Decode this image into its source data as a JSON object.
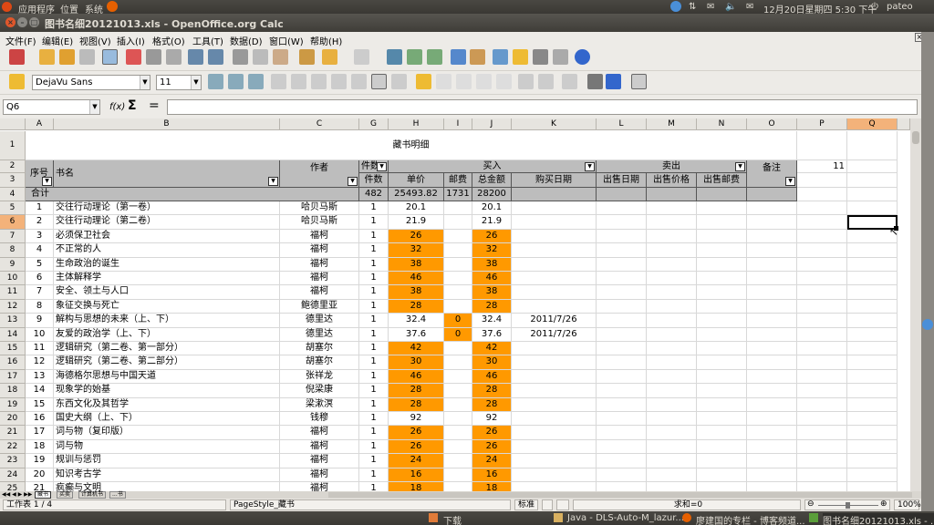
{
  "topbar": {
    "apps": "应用程序",
    "places": "位置",
    "system": "系统",
    "datetime": "12月20日星期四 5:30 下午",
    "user": "pateo"
  },
  "window": {
    "title": "图书名细20121013.xls - OpenOffice.org Calc"
  },
  "menu": [
    "文件(F)",
    "编辑(E)",
    "视图(V)",
    "插入(I)",
    "格式(O)",
    "工具(T)",
    "数据(D)",
    "窗口(W)",
    "帮助(H)"
  ],
  "format": {
    "font": "DejaVu Sans",
    "size": "11"
  },
  "formula": {
    "namebox": "Q6",
    "fx": "f(x)",
    "sigma": "Σ",
    "value": ""
  },
  "columns": [
    "A",
    "B",
    "C",
    "G",
    "H",
    "I",
    "J",
    "K",
    "L",
    "M",
    "N",
    "O",
    "P",
    "Q"
  ],
  "header": {
    "title": "藏书明细",
    "seq": "序号",
    "book": "书名",
    "author": "作者",
    "count": "件数",
    "buy": "买入",
    "sell": "卖出",
    "note": "备注",
    "p2": "11",
    "count2": "件数",
    "price": "单价",
    "post": "邮费",
    "total": "总金额",
    "date": "购买日期",
    "sdate": "出售日期",
    "sprice": "出售价格",
    "spost": "出售邮费",
    "sum_label": "合计",
    "sum_count": "482",
    "sum_price": "25493.82",
    "sum_post": "1731",
    "sum_total": "28200"
  },
  "rows": [
    {
      "r": "5",
      "n": "1",
      "b": "交往行动理论（第一卷）",
      "a": "哈贝马斯",
      "g": "1",
      "h": "20.1",
      "i": "",
      "j": "20.1",
      "k": "",
      "o": false
    },
    {
      "r": "6",
      "n": "2",
      "b": "交往行动理论（第二卷）",
      "a": "哈贝马斯",
      "g": "1",
      "h": "21.9",
      "i": "",
      "j": "21.9",
      "k": "",
      "o": false
    },
    {
      "r": "7",
      "n": "3",
      "b": "必须保卫社会",
      "a": "福柯",
      "g": "1",
      "h": "26",
      "i": "",
      "j": "26",
      "k": "",
      "o": true
    },
    {
      "r": "8",
      "n": "4",
      "b": "不正常的人",
      "a": "福柯",
      "g": "1",
      "h": "32",
      "i": "",
      "j": "32",
      "k": "",
      "o": true
    },
    {
      "r": "9",
      "n": "5",
      "b": "生命政治的诞生",
      "a": "福柯",
      "g": "1",
      "h": "38",
      "i": "",
      "j": "38",
      "k": "",
      "o": true
    },
    {
      "r": "10",
      "n": "6",
      "b": "主体解释学",
      "a": "福柯",
      "g": "1",
      "h": "46",
      "i": "",
      "j": "46",
      "k": "",
      "o": true
    },
    {
      "r": "11",
      "n": "7",
      "b": "安全、领土与人口",
      "a": "福柯",
      "g": "1",
      "h": "38",
      "i": "",
      "j": "38",
      "k": "",
      "o": true
    },
    {
      "r": "12",
      "n": "8",
      "b": "象征交换与死亡",
      "a": "鲍德里亚",
      "g": "1",
      "h": "28",
      "i": "",
      "j": "28",
      "k": "",
      "o": true
    },
    {
      "r": "13",
      "n": "9",
      "b": "解构与思想的未来（上、下）",
      "a": "德里达",
      "g": "1",
      "h": "32.4",
      "i": "0",
      "j": "32.4",
      "k": "2011/7/26",
      "o": false
    },
    {
      "r": "14",
      "n": "10",
      "b": "友爱的政治学（上、下）",
      "a": "德里达",
      "g": "1",
      "h": "37.6",
      "i": "0",
      "j": "37.6",
      "k": "2011/7/26",
      "o": false
    },
    {
      "r": "15",
      "n": "11",
      "b": "逻辑研究（第二卷、第一部分）",
      "a": "胡塞尔",
      "g": "1",
      "h": "42",
      "i": "",
      "j": "42",
      "k": "",
      "o": true
    },
    {
      "r": "16",
      "n": "12",
      "b": "逻辑研究（第二卷、第二部分）",
      "a": "胡塞尔",
      "g": "1",
      "h": "30",
      "i": "",
      "j": "30",
      "k": "",
      "o": true
    },
    {
      "r": "17",
      "n": "13",
      "b": "海德格尔思想与中国天道",
      "a": "张祥龙",
      "g": "1",
      "h": "46",
      "i": "",
      "j": "46",
      "k": "",
      "o": true
    },
    {
      "r": "18",
      "n": "14",
      "b": "现象学的始基",
      "a": "倪梁康",
      "g": "1",
      "h": "28",
      "i": "",
      "j": "28",
      "k": "",
      "o": true
    },
    {
      "r": "19",
      "n": "15",
      "b": "东西文化及其哲学",
      "a": "梁漱溟",
      "g": "1",
      "h": "28",
      "i": "",
      "j": "28",
      "k": "",
      "o": true
    },
    {
      "r": "20",
      "n": "16",
      "b": "国史大纲（上、下）",
      "a": "钱穆",
      "g": "1",
      "h": "92",
      "i": "",
      "j": "92",
      "k": "",
      "o": false
    },
    {
      "r": "21",
      "n": "17",
      "b": "词与物（复印版）",
      "a": "福柯",
      "g": "1",
      "h": "26",
      "i": "",
      "j": "26",
      "k": "",
      "o": true
    },
    {
      "r": "22",
      "n": "18",
      "b": "词与物",
      "a": "福柯",
      "g": "1",
      "h": "26",
      "i": "",
      "j": "26",
      "k": "",
      "o": true
    },
    {
      "r": "23",
      "n": "19",
      "b": "规训与惩罚",
      "a": "福柯",
      "g": "1",
      "h": "24",
      "i": "",
      "j": "24",
      "k": "",
      "o": true
    },
    {
      "r": "24",
      "n": "20",
      "b": "知识考古学",
      "a": "福柯",
      "g": "1",
      "h": "16",
      "i": "",
      "j": "16",
      "k": "",
      "o": true
    },
    {
      "r": "25",
      "n": "21",
      "b": "疯癫与文明",
      "a": "福柯",
      "g": "1",
      "h": "18",
      "i": "",
      "j": "18",
      "k": "",
      "o": true
    }
  ],
  "sheet_tabs": [
    "藏书",
    "买卖",
    "计算机书",
    "...书"
  ],
  "status": {
    "sheet": "工作表 1 / 4",
    "style": "PageStyle_藏书",
    "mode": "标准",
    "sum": "求和=0",
    "zoom": "100%"
  },
  "panel": {
    "download": "下载",
    "task1": "Java - DLS-Auto-M_lazur...",
    "task2": "廖建国的专栏 - 博客频道...",
    "task3": "图书名细20121013.xls - ..."
  }
}
